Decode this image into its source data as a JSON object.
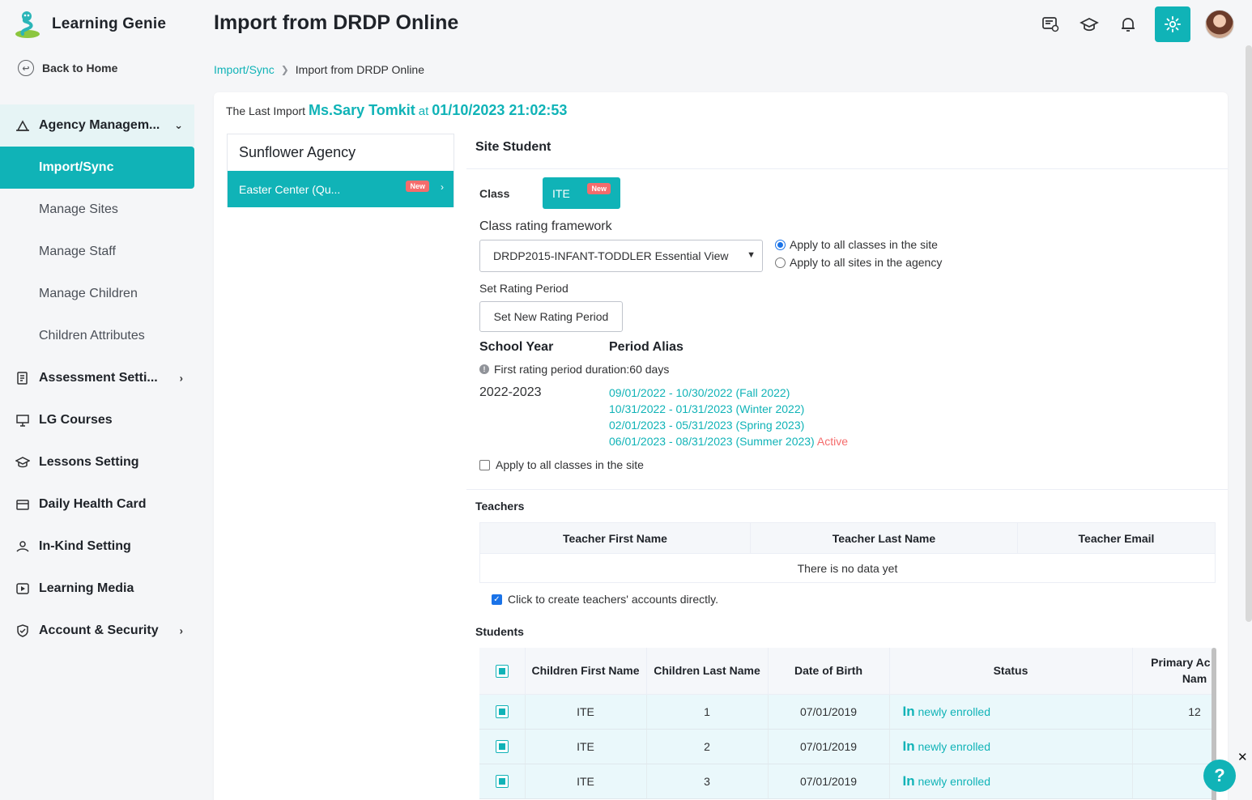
{
  "app": {
    "name": "Learning Genie"
  },
  "sidebar": {
    "back_label": "Back to Home",
    "group": {
      "label": "Agency Managem...",
      "items": [
        "Import/Sync",
        "Manage Sites",
        "Manage Staff",
        "Manage Children",
        "Children Attributes"
      ]
    },
    "items": [
      {
        "label": "Assessment Setti...",
        "icon": "assessment-icon"
      },
      {
        "label": "LG Courses",
        "icon": "presentation-icon"
      },
      {
        "label": "Lessons Setting",
        "icon": "graduation-cap-icon"
      },
      {
        "label": "Daily Health Card",
        "icon": "health-card-icon"
      },
      {
        "label": "In-Kind Setting",
        "icon": "hand-heart-icon"
      },
      {
        "label": "Learning Media",
        "icon": "play-icon"
      },
      {
        "label": "Account & Security",
        "icon": "shield-icon"
      }
    ]
  },
  "header": {
    "title": "Import from DRDP Online",
    "breadcrumb": {
      "parent": "Import/Sync",
      "current": "Import from DRDP Online"
    }
  },
  "last_import": {
    "prefix": "The Last Import",
    "user": "Ms.Sary Tomkit",
    "at": "at",
    "timestamp": "01/10/2023 21:02:53"
  },
  "agency": {
    "name": "Sunflower Agency",
    "site": "Easter Center (Qu...",
    "badge": "New"
  },
  "site_student": {
    "title": "Site Student",
    "class_label": "Class",
    "class_name": "ITE",
    "class_badge": "New",
    "framework_label": "Class rating framework",
    "framework_value": "DRDP2015-INFANT-TODDLER Essential View",
    "radio_site": "Apply to all classes in the site",
    "radio_agency": "Apply to all sites in the agency",
    "rating_label": "Set Rating Period",
    "rating_button": "Set New Rating Period",
    "school_year_head": "School Year",
    "period_alias_head": "Period Alias",
    "info": "First rating period duration:60 days",
    "year": "2022-2023",
    "periods": [
      "09/01/2022 - 10/30/2022 (Fall 2022)",
      "10/31/2022 - 01/31/2023 (Winter 2022)",
      "02/01/2023 - 05/31/2023 (Spring 2023)",
      "06/01/2023 - 08/31/2023 (Summer 2023)"
    ],
    "active_label": "Active",
    "apply_all": "Apply to all classes in the site"
  },
  "teachers": {
    "title": "Teachers",
    "columns": [
      "Teacher First Name",
      "Teacher Last Name",
      "Teacher Email"
    ],
    "empty": "There is no data yet",
    "create_accounts": "Click to create teachers' accounts directly."
  },
  "students": {
    "title": "Students",
    "columns": [
      "Children First Name",
      "Children Last Name",
      "Date of Birth",
      "Status",
      "Primary Ac First Nam"
    ],
    "rows": [
      {
        "first": "ITE",
        "last": "1",
        "dob": "07/01/2019",
        "status_in": "In",
        "status_text": "newly enrolled",
        "primary": "12"
      },
      {
        "first": "ITE",
        "last": "2",
        "dob": "07/01/2019",
        "status_in": "In",
        "status_text": "newly enrolled",
        "primary": ""
      },
      {
        "first": "ITE",
        "last": "3",
        "dob": "07/01/2019",
        "status_in": "In",
        "status_text": "newly enrolled",
        "primary": ""
      }
    ]
  },
  "help": {
    "label": "?",
    "close": "✕"
  },
  "colors": {
    "accent": "#10b3b7",
    "danger": "#f56c6c",
    "radio": "#1a73e8"
  }
}
